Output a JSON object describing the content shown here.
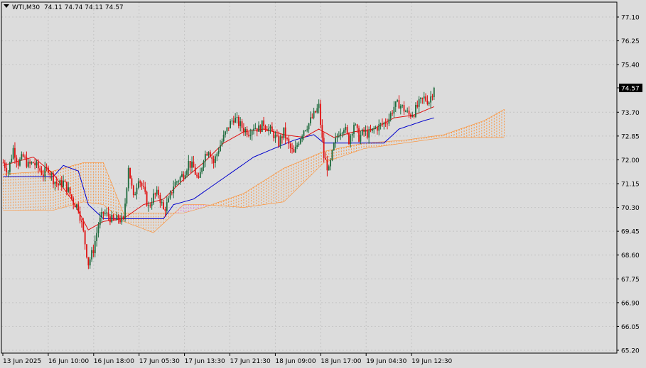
{
  "header": {
    "symbol": "WTI,M30",
    "ohlc": "74.11 74.74 74.11 74.57"
  },
  "colors": {
    "background": "#dcdcdc",
    "grid": "#c4c4c4",
    "axis": "#000000",
    "bull_candle": "#1e6b3e",
    "bear_candle": "#e01010",
    "tenkan": "#e01010",
    "kijun": "#0000cc",
    "cloud": "#ff8c2a",
    "cloud_b": "#e86ad8",
    "price_tag_bg": "#000000",
    "price_tag_fg": "#ffffff"
  },
  "chart_data": {
    "type": "candlestick",
    "symbol": "WTI",
    "timeframe": "M30",
    "y_ticks": [
      77.1,
      76.25,
      75.4,
      74.57,
      73.7,
      72.85,
      72.0,
      71.15,
      70.3,
      69.45,
      68.6,
      67.75,
      66.9,
      66.05,
      65.2
    ],
    "y_tick_labels": [
      "77.10",
      "76.25",
      "75.40",
      "74.57",
      "73.70",
      "72.85",
      "72.00",
      "71.15",
      "70.30",
      "69.45",
      "68.60",
      "67.75",
      "66.90",
      "66.05",
      "65.20"
    ],
    "ylim": [
      65.2,
      77.55
    ],
    "x_tick_labels": [
      "13 Jun 2025",
      "16 Jun 10:00",
      "16 Jun 18:00",
      "17 Jun 05:30",
      "17 Jun 13:30",
      "17 Jun 21:30",
      "18 Jun 09:00",
      "18 Jun 17:00",
      "19 Jun 04:30",
      "19 Jun 12:30"
    ],
    "current_price": "74.57",
    "grid": true,
    "close_path": [
      [
        0,
        71.9
      ],
      [
        1,
        71.6
      ],
      [
        2,
        72.4
      ],
      [
        3,
        71.9
      ],
      [
        4,
        72.1
      ],
      [
        5,
        71.8
      ],
      [
        6,
        71.9
      ],
      [
        7,
        71.7
      ],
      [
        8,
        71.5
      ],
      [
        9,
        71.7
      ],
      [
        10,
        71.3
      ],
      [
        11,
        71.1
      ],
      [
        12,
        71.2
      ],
      [
        13,
        70.9
      ],
      [
        14,
        70.5
      ],
      [
        15,
        70.3
      ],
      [
        16,
        69.4
      ],
      [
        17,
        68.3
      ],
      [
        18,
        68.8
      ],
      [
        19,
        69.7
      ],
      [
        20,
        70.1
      ],
      [
        21,
        70.0
      ],
      [
        22,
        69.8
      ],
      [
        23,
        69.9
      ],
      [
        24,
        69.8
      ],
      [
        25,
        71.8
      ],
      [
        26,
        70.6
      ],
      [
        27,
        71.4
      ],
      [
        28,
        70.9
      ],
      [
        29,
        70.3
      ],
      [
        30,
        70.7
      ],
      [
        31,
        70.8
      ],
      [
        32,
        70.2
      ],
      [
        33,
        70.5
      ],
      [
        34,
        71.1
      ],
      [
        35,
        71.3
      ],
      [
        36,
        71.5
      ],
      [
        37,
        71.9
      ],
      [
        38,
        71.7
      ],
      [
        39,
        71.2
      ],
      [
        40,
        72.1
      ],
      [
        41,
        72.4
      ],
      [
        42,
        71.9
      ],
      [
        43,
        72.4
      ],
      [
        44,
        72.8
      ],
      [
        45,
        73.2
      ],
      [
        46,
        73.5
      ],
      [
        47,
        73.3
      ],
      [
        48,
        73.1
      ],
      [
        49,
        73.0
      ],
      [
        50,
        73.2
      ],
      [
        51,
        73.1
      ],
      [
        52,
        73.3
      ],
      [
        53,
        73.1
      ],
      [
        54,
        72.9
      ],
      [
        55,
        72.6
      ],
      [
        56,
        73.0
      ],
      [
        57,
        72.5
      ],
      [
        58,
        72.2
      ],
      [
        59,
        72.7
      ],
      [
        60,
        73.1
      ],
      [
        61,
        73.3
      ],
      [
        62,
        73.6
      ],
      [
        63,
        73.9
      ],
      [
        64,
        72.1
      ],
      [
        65,
        71.6
      ],
      [
        66,
        72.5
      ],
      [
        67,
        73.0
      ],
      [
        68,
        73.2
      ],
      [
        69,
        72.7
      ],
      [
        70,
        73.3
      ],
      [
        71,
        72.8
      ],
      [
        72,
        73.0
      ],
      [
        73,
        72.9
      ],
      [
        74,
        73.1
      ],
      [
        75,
        73.2
      ],
      [
        76,
        73.3
      ],
      [
        77,
        73.5
      ],
      [
        78,
        73.9
      ],
      [
        79,
        74.0
      ],
      [
        80,
        73.8
      ],
      [
        81,
        73.6
      ],
      [
        82,
        73.7
      ],
      [
        83,
        74.0
      ],
      [
        84,
        74.2
      ],
      [
        85,
        74.1
      ],
      [
        86,
        74.57
      ]
    ],
    "tenkan_path": [
      [
        0,
        71.8
      ],
      [
        6,
        72.1
      ],
      [
        10,
        71.5
      ],
      [
        14,
        70.5
      ],
      [
        17,
        69.5
      ],
      [
        20,
        69.8
      ],
      [
        24,
        69.9
      ],
      [
        28,
        70.4
      ],
      [
        32,
        70.6
      ],
      [
        36,
        71.3
      ],
      [
        40,
        71.9
      ],
      [
        44,
        72.6
      ],
      [
        48,
        73.0
      ],
      [
        52,
        73.1
      ],
      [
        56,
        72.9
      ],
      [
        60,
        72.8
      ],
      [
        63,
        73.1
      ],
      [
        66,
        72.8
      ],
      [
        70,
        73.0
      ],
      [
        74,
        73.1
      ],
      [
        78,
        73.5
      ],
      [
        82,
        73.6
      ],
      [
        86,
        73.9
      ]
    ],
    "kijun_path": [
      [
        0,
        71.4
      ],
      [
        10,
        71.4
      ],
      [
        12,
        71.8
      ],
      [
        15,
        71.6
      ],
      [
        17,
        70.4
      ],
      [
        20,
        69.9
      ],
      [
        26,
        69.9
      ],
      [
        32,
        69.9
      ],
      [
        34,
        70.4
      ],
      [
        38,
        70.6
      ],
      [
        42,
        71.1
      ],
      [
        46,
        71.6
      ],
      [
        50,
        72.1
      ],
      [
        54,
        72.4
      ],
      [
        58,
        72.7
      ],
      [
        62,
        72.9
      ],
      [
        64,
        72.6
      ],
      [
        70,
        72.6
      ],
      [
        76,
        72.6
      ],
      [
        79,
        73.1
      ],
      [
        84,
        73.4
      ],
      [
        86,
        73.5
      ]
    ],
    "cloud_a_path": [
      [
        0,
        71.5
      ],
      [
        10,
        71.6
      ],
      [
        16,
        71.9
      ],
      [
        20,
        71.9
      ],
      [
        24,
        70.1
      ],
      [
        30,
        70.1
      ],
      [
        36,
        70.1
      ],
      [
        40,
        70.3
      ],
      [
        48,
        70.8
      ],
      [
        56,
        71.7
      ],
      [
        64,
        72.3
      ],
      [
        72,
        72.6
      ],
      [
        80,
        72.7
      ],
      [
        88,
        72.9
      ],
      [
        96,
        73.4
      ],
      [
        100,
        73.8
      ]
    ],
    "cloud_b_path": [
      [
        0,
        70.2
      ],
      [
        10,
        70.2
      ],
      [
        16,
        70.5
      ],
      [
        20,
        70.4
      ],
      [
        24,
        69.8
      ],
      [
        30,
        69.4
      ],
      [
        36,
        70.4
      ],
      [
        40,
        70.4
      ],
      [
        48,
        70.3
      ],
      [
        56,
        70.5
      ],
      [
        64,
        71.9
      ],
      [
        72,
        72.4
      ],
      [
        80,
        72.6
      ],
      [
        88,
        72.8
      ],
      [
        96,
        72.8
      ],
      [
        100,
        72.8
      ]
    ]
  }
}
